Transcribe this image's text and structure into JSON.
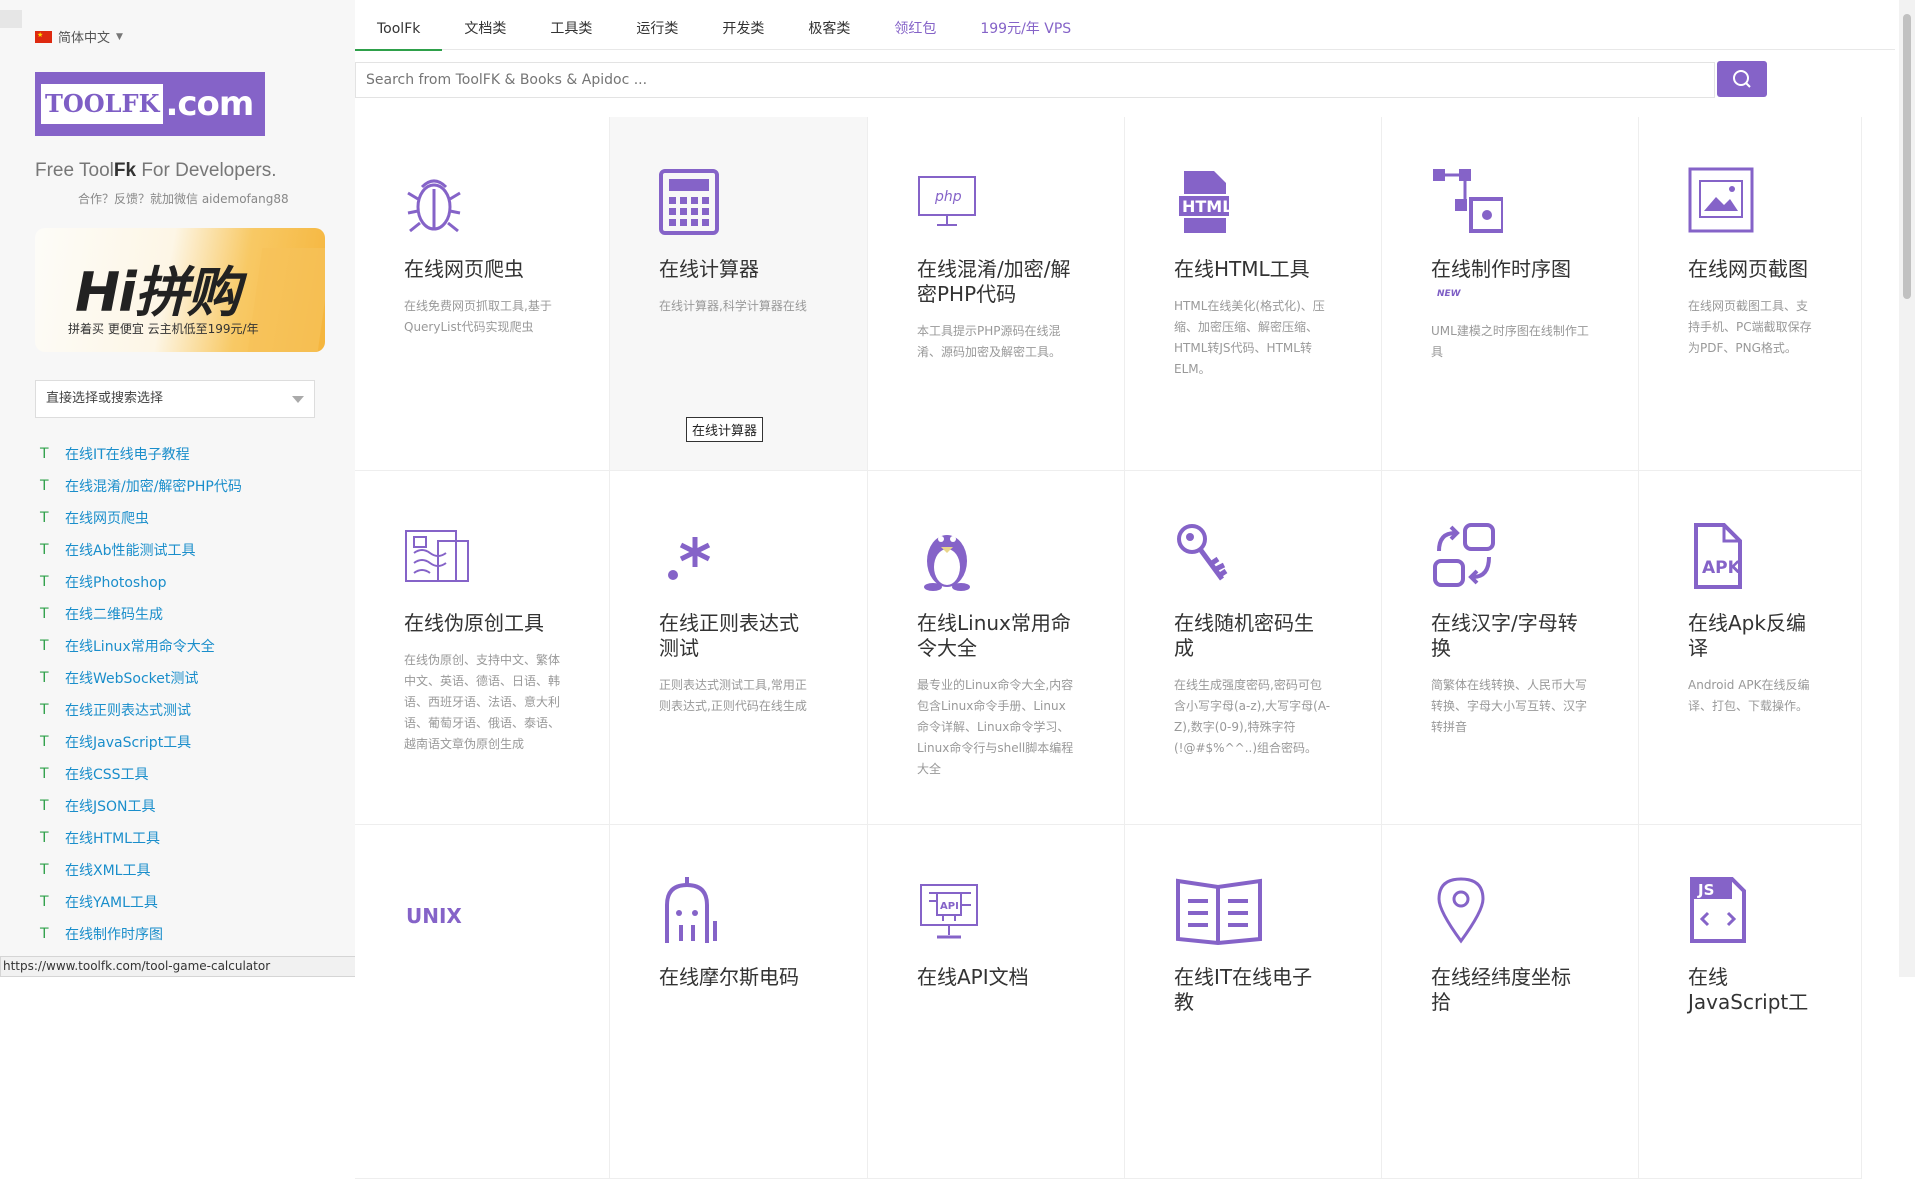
{
  "colors": {
    "accent": "#8563c8",
    "link": "#1a8ecb",
    "green": "#2ea04a"
  },
  "sidebar": {
    "language": "简体中文",
    "logo_left": "TOOLFK",
    "logo_right": ".com",
    "tagline_pre": "Free Tool",
    "tagline_bold": "Fk",
    "tagline_post": " For Developers.",
    "contact": "合作？反馈？就加微信 aidemofang88",
    "banner_title": "Hi拼购",
    "banner_sub": "拼着买 更便宜 云主机低至199元/年",
    "select_placeholder": "直接选择或搜索选择",
    "items": [
      {
        "label": "在线IT在线电子教程"
      },
      {
        "label": "在线混淆/加密/解密PHP代码"
      },
      {
        "label": "在线网页爬虫"
      },
      {
        "label": "在线Ab性能测试工具"
      },
      {
        "label": "在线Photoshop"
      },
      {
        "label": "在线二维码生成"
      },
      {
        "label": "在线Linux常用命令大全"
      },
      {
        "label": "在线WebSocket测试"
      },
      {
        "label": "在线正则表达式测试"
      },
      {
        "label": "在线JavaScript工具"
      },
      {
        "label": "在线CSS工具"
      },
      {
        "label": "在线JSON工具"
      },
      {
        "label": "在线HTML工具"
      },
      {
        "label": "在线XML工具"
      },
      {
        "label": "在线YAML工具"
      },
      {
        "label": "在线制作时序图"
      }
    ],
    "item_icon": "T"
  },
  "status_url": "https://www.toolfk.com/tool-game-calculator",
  "nav": {
    "tabs": [
      "ToolFk",
      "文档类",
      "工具类",
      "运行类",
      "开发类",
      "极客类",
      "领红包",
      "199元/年 VPS"
    ]
  },
  "search": {
    "placeholder": "Search from ToolFK & Books & Apidoc ..."
  },
  "cards": [
    {
      "title": "在线网页爬虫",
      "desc": "在线免费网页抓取工具,基于QueryList代码实现爬虫",
      "icon": "bug-icon"
    },
    {
      "title": "在线计算器",
      "desc": "在线计算器,科学计算器在线",
      "icon": "calculator-icon"
    },
    {
      "title": "在线混淆/加密/解密PHP代码",
      "desc": "本工具提示PHP源码在线混淆、源码加密及解密工具。",
      "icon": "php-icon"
    },
    {
      "title": "在线HTML工具",
      "desc": "HTML在线美化(格式化)、压缩、加密压缩、解密压缩、HTML转JS代码、HTML转ELM。",
      "icon": "html-icon"
    },
    {
      "title": "在线制作时序图",
      "desc": "UML建模之时序图在线制作工具",
      "icon": "sequence-diagram-icon",
      "badge": "NEW"
    },
    {
      "title": "在线网页截图",
      "desc": "在线网页截图工具、支持手机、PC端截取保存为PDF、PNG格式。",
      "icon": "screenshot-icon"
    },
    {
      "title": "在线伪原创工具",
      "desc": "在线伪原创、支持中文、繁体中文、英语、德语、日语、韩语、西班牙语、法语、意大利语、葡萄牙语、俄语、泰语、越南语文章伪原创生成",
      "icon": "document-icon"
    },
    {
      "title": "在线正则表达式测试",
      "desc": "正则表达式测试工具,常用正则表达式,正则代码在线生成",
      "icon": "regex-icon"
    },
    {
      "title": "在线Linux常用命令大全",
      "desc": "最专业的Linux命令大全,内容包含Linux命令手册、Linux命令详解、Linux命令学习、Linux命令行与shell脚本编程大全",
      "icon": "linux-penguin-icon"
    },
    {
      "title": "在线随机密码生成",
      "desc": "在线生成强度密码,密码可包含小写字母(a-z),大写字母(A-Z),数字(0-9),特殊字符(!@#$%^^..)组合密码。",
      "icon": "key-icon"
    },
    {
      "title": "在线汉字/字母转换",
      "desc": "简繁体在线转换、人民币大写转换、字母大小写互转、汉字转拼音",
      "icon": "convert-icon"
    },
    {
      "title": "在线Apk反编译",
      "desc": "Android APK在线反编译、打包、下载操作。",
      "icon": "apk-icon"
    },
    {
      "title": "",
      "desc": "",
      "icon": "unix-icon",
      "icon_text": "UNIX"
    },
    {
      "title": "在线摩尔斯电码",
      "desc": "",
      "icon": "robot-icon"
    },
    {
      "title": "在线API文档",
      "desc": "",
      "icon": "api-icon"
    },
    {
      "title": "在线IT在线电子教",
      "desc": "",
      "icon": "book-icon"
    },
    {
      "title": "在线经纬度坐标拾",
      "desc": "",
      "icon": "location-pin-icon"
    },
    {
      "title": "在线JavaScript工",
      "desc": "",
      "icon": "js-file-icon"
    }
  ],
  "tooltip": "在线计算器"
}
